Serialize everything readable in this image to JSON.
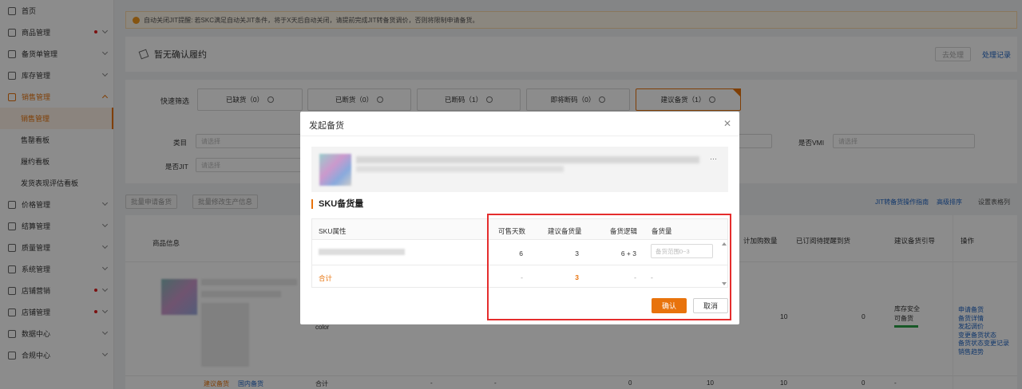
{
  "sidebar": {
    "items": [
      {
        "label": "首页",
        "icon": "home-icon",
        "chevron": false,
        "dot": false
      },
      {
        "label": "商品管理",
        "icon": "goods-icon",
        "chevron": true,
        "dot": true
      },
      {
        "label": "备货单管理",
        "icon": "order-icon",
        "chevron": true,
        "dot": false
      },
      {
        "label": "库存管理",
        "icon": "inventory-icon",
        "chevron": true,
        "dot": false
      },
      {
        "label": "销售管理",
        "icon": "sales-icon",
        "chevron": true,
        "dot": false,
        "active": true
      }
    ],
    "subitems": [
      {
        "label": "销售管理",
        "active": true
      },
      {
        "label": "售罄看板"
      },
      {
        "label": "履约看板"
      },
      {
        "label": "发货表现评估看板"
      }
    ],
    "items2": [
      {
        "label": "价格管理",
        "icon": "price-icon",
        "dot": false
      },
      {
        "label": "结算管理",
        "icon": "settle-icon",
        "dot": false
      },
      {
        "label": "质量管理",
        "icon": "quality-icon",
        "dot": false
      },
      {
        "label": "系统管理",
        "icon": "system-icon",
        "dot": false
      },
      {
        "label": "店铺营销",
        "icon": "marketing-icon",
        "dot": true
      },
      {
        "label": "店铺管理",
        "icon": "shop-icon",
        "dot": true
      },
      {
        "label": "数据中心",
        "icon": "data-icon",
        "dot": false
      },
      {
        "label": "合规中心",
        "icon": "compliance-icon",
        "dot": false
      }
    ]
  },
  "notice": "自动关闭JIT提醒: 若SKC满足自动关JIT条件，将于X天后自动关闭，请提前完成JIT转备货调价，否则将限制申请备货。",
  "header": {
    "title": "暂无确认履约",
    "pending_btn": "去处理",
    "records_link": "处理记录"
  },
  "filters": {
    "quick_label": "快速筛选",
    "quick": [
      {
        "label": "已缺货（0）"
      },
      {
        "label": "已断货（0）"
      },
      {
        "label": "已断码（1）"
      },
      {
        "label": "即将断码（0）"
      },
      {
        "label": "建议备货（1）",
        "active": true
      }
    ],
    "category_label": "类目",
    "category_placeholder": "请选择",
    "jit_label": "是否JIT",
    "jit_placeholder": "请选择",
    "vmi_label": "是否VMI",
    "vmi_placeholder": "请选择"
  },
  "actions": {
    "batch_apply": "批量申请备货",
    "batch_edit": "批量修改生产信息",
    "jit_guide": "JIT转备货操作指南",
    "advanced_sort": "高级排序",
    "set_columns": "设置表格列"
  },
  "table": {
    "headers": {
      "product": "商品信息",
      "plan_qty": "计加购数量",
      "subscribed": "已订阅待提醒到货",
      "suggest_guide": "建议备货引导",
      "ops": "操作"
    },
    "row": {
      "color": "color",
      "plan_qty": "10",
      "subscribed": "0",
      "status1": "库存安全",
      "status2": "可备货",
      "ops": [
        "申请备货",
        "备货详情",
        "发起调价",
        "变更备货状态",
        "备货状态变更记录",
        "销售趋势"
      ]
    },
    "total_row": {
      "label": "合计",
      "suggest_link": "建议备货",
      "domestic_link": "国内备货",
      "values": [
        "-",
        "-",
        "0",
        "10",
        "10",
        "0",
        "-"
      ]
    }
  },
  "modal": {
    "title": "发起备货",
    "section_title": "SKU备货量",
    "columns": [
      "SKU属性",
      "可售天数",
      "建议备货量",
      "备货逻辑",
      "备货量"
    ],
    "row": {
      "days": "6",
      "suggest": "3",
      "logic": "6 + 3",
      "qty_placeholder": "备货范围0~3"
    },
    "total": {
      "label": "合计",
      "days": "-",
      "suggest": "3",
      "logic": "-",
      "qty": "-"
    },
    "confirm": "确认",
    "cancel": "取消"
  }
}
